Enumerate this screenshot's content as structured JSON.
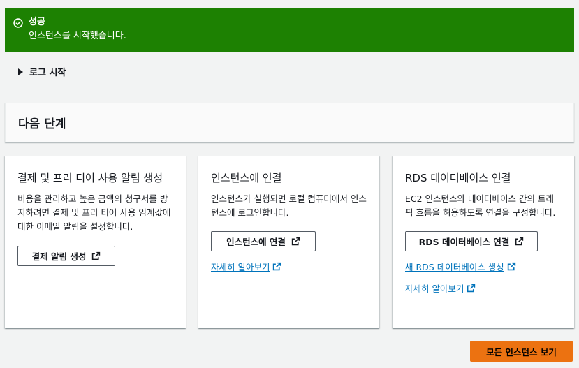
{
  "flash": {
    "status": "success",
    "icon": "check-circle-icon",
    "color": "#1d8102",
    "title": "성공",
    "message": "인스턴스를 시작했습니다."
  },
  "log_expander": {
    "label": "로그 시작",
    "expanded": false
  },
  "next_steps": {
    "heading": "다음 단계",
    "cards": [
      {
        "title": "결제 및 프리 티어 사용 알림 생성",
        "description": "비용을 관리하고 높은 금액의 청구서를 방지하려면 결제 및 프리 티어 사용 임계값에 대한 이메일 알림을 설정합니다.",
        "button": "결제 알림 생성"
      },
      {
        "title": "인스턴스에 연결",
        "description": "인스턴스가 실행되면 로컬 컴퓨터에서 인스턴스에 로그인합니다.",
        "button": "인스턴스에 연결",
        "links": [
          "자세히 알아보기"
        ]
      },
      {
        "title": "RDS 데이터베이스 연결",
        "description": "EC2 인스턴스와 데이터베이스 간의 트래픽 흐름을 허용하도록 연결을 구성합니다.",
        "button": "RDS 데이터베이스 연결",
        "links": [
          "새 RDS 데이터베이스 생성",
          "자세히 알아보기"
        ]
      }
    ]
  },
  "primary_button": {
    "label": "모든 인스턴스 보기",
    "color": "#ec7211"
  },
  "colors": {
    "link": "#0073bb",
    "background": "#f2f3f3"
  }
}
